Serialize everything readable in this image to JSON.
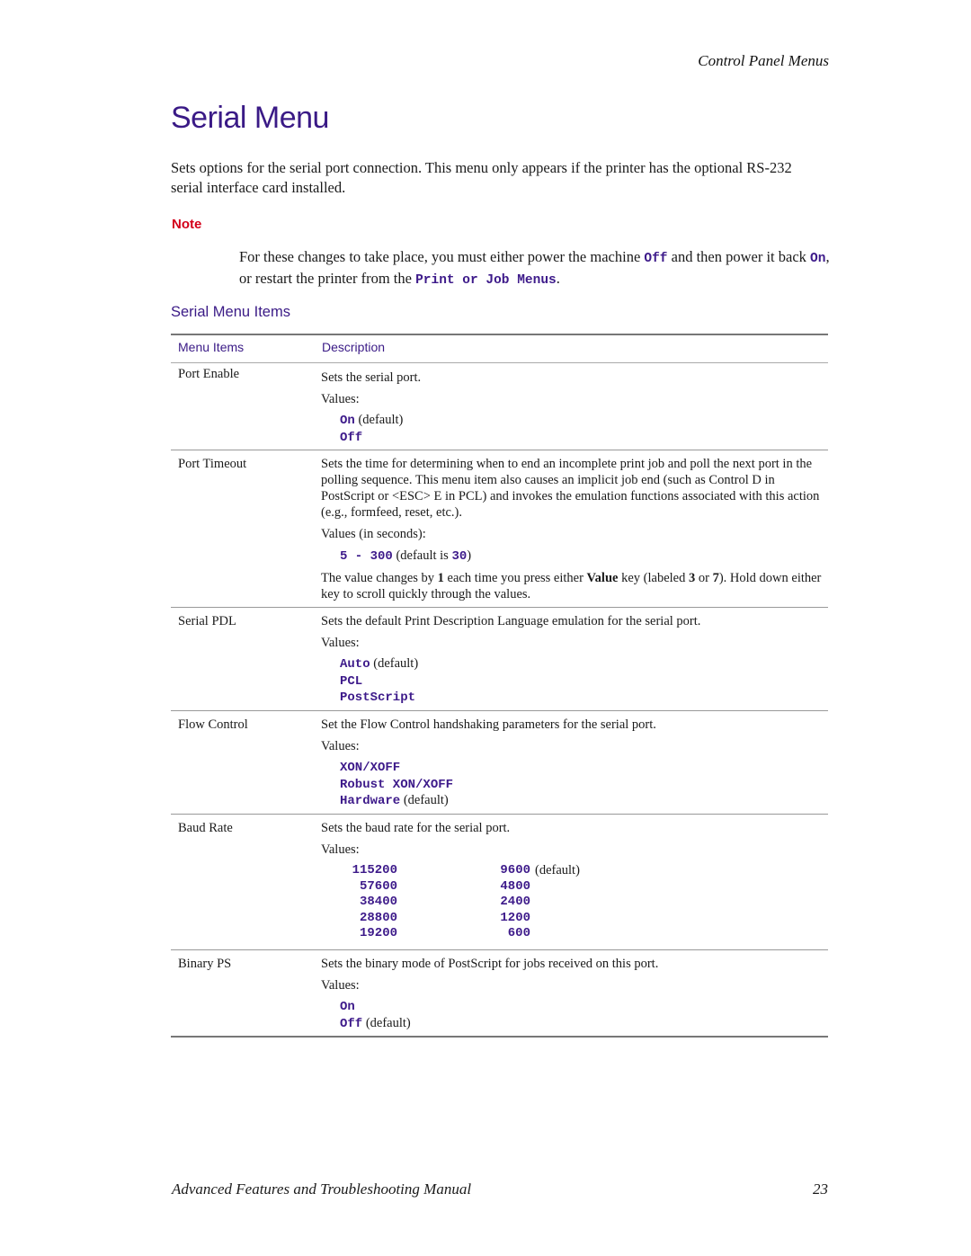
{
  "header": {
    "running_head": "Control Panel Menus"
  },
  "title": "Serial Menu",
  "intro": "Sets options for the serial port connection. This menu only appears if the printer has the optional RS-232 serial interface card installed.",
  "note": {
    "label": "Note",
    "text_1": "For these changes to take place, you must either power the machine ",
    "code_1": "Off",
    "text_2": "  and then power it back ",
    "code_2": "On",
    "text_3": ", or restart the printer from the ",
    "code_3": "Print or Job Menus",
    "text_4": "."
  },
  "section_title": "Serial Menu Items",
  "table": {
    "headers": {
      "item": "Menu Items",
      "description": "Description"
    },
    "rows": [
      {
        "name": "Port Enable",
        "description": "Sets the serial port.",
        "values_label": "Values:",
        "values": [
          {
            "code": "On",
            "note": " (default)"
          },
          {
            "code": "Off",
            "note": ""
          }
        ]
      },
      {
        "name": "Port Timeout",
        "description": "Sets the time for determining when to end an incomplete print job and poll the next port in the polling sequence. This menu item also causes an implicit job end (such as Control D in PostScript or <ESC> E in PCL) and invokes the emulation functions associated with this action (e.g., formfeed, reset, etc.).",
        "values_label": "Values (in seconds):",
        "range": {
          "code": "5 - 300",
          "note_pre": "  (default is ",
          "default_code": "30",
          "note_post": ")"
        },
        "extra": {
          "t1": "The value changes by ",
          "b1": "1",
          "t2": " each time you press either ",
          "b2": "Value",
          "t3": " key (labeled ",
          "b3": "3",
          "t4": " or ",
          "b4": "7",
          "t5": "). Hold down either key to scroll quickly through the values."
        }
      },
      {
        "name": "Serial PDL",
        "description": "Sets the default Print Description Language emulation for the serial port.",
        "values_label": "Values:",
        "values": [
          {
            "code": "Auto",
            "note": " (default)"
          },
          {
            "code": "PCL",
            "note": ""
          },
          {
            "code": "PostScript",
            "note": ""
          }
        ]
      },
      {
        "name": "Flow Control",
        "description": "Set the Flow Control handshaking parameters for the serial port.",
        "values_label": "Values:",
        "values": [
          {
            "code": "XON/XOFF",
            "note": ""
          },
          {
            "code": "Robust XON/XOFF",
            "note": ""
          },
          {
            "code": "Hardware",
            "note": " (default)"
          }
        ]
      },
      {
        "name": "Baud Rate",
        "description": "Sets the baud rate for the serial port.",
        "values_label": "Values:",
        "baud_rows": [
          {
            "left": "115200",
            "right": "9600",
            "note": "(default)"
          },
          {
            "left": "57600",
            "right": "4800",
            "note": ""
          },
          {
            "left": "38400",
            "right": "2400",
            "note": ""
          },
          {
            "left": "28800",
            "right": "1200",
            "note": ""
          },
          {
            "left": "19200",
            "right": "600",
            "note": ""
          }
        ]
      },
      {
        "name": "Binary PS",
        "description": "Sets the binary mode of PostScript for jobs received on this port.",
        "values_label": "Values:",
        "values": [
          {
            "code": "On",
            "note": ""
          },
          {
            "code": "Off",
            "note": " (default)"
          }
        ]
      }
    ]
  },
  "footer": {
    "title": "Advanced Features and Troubleshooting Manual",
    "page_number": "23"
  }
}
